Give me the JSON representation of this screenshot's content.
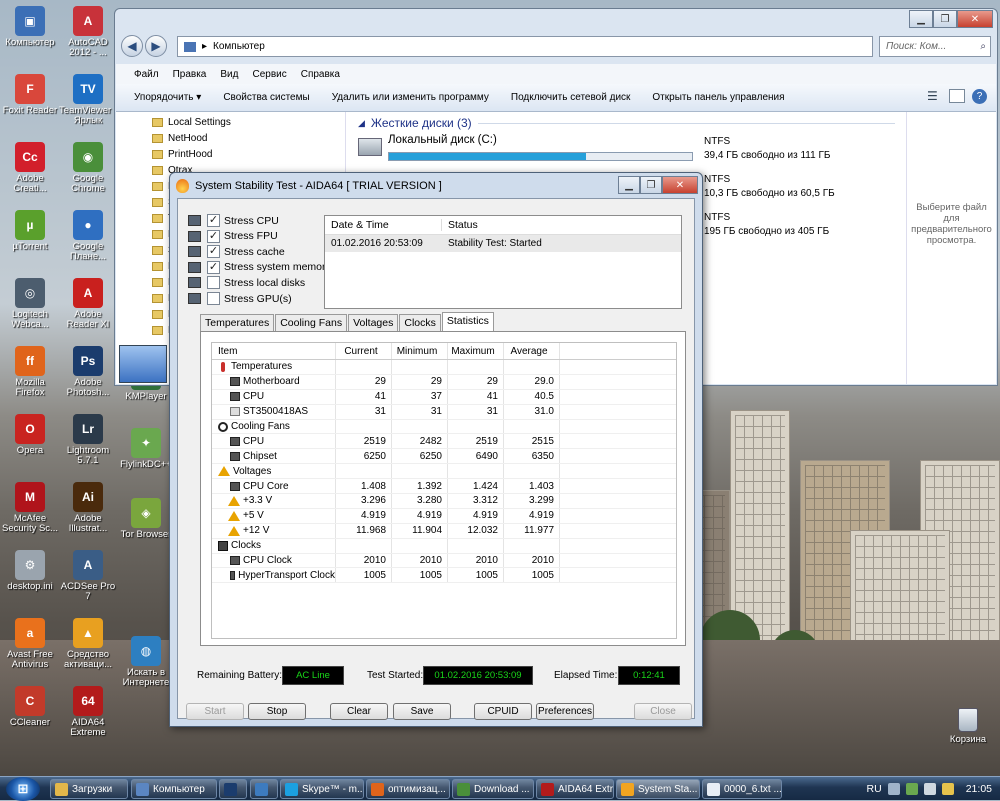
{
  "desktop": {
    "icons": [
      {
        "label": "Компьютер",
        "color": "#3b6fb6",
        "glyph": "▣"
      },
      {
        "label": "AutoCAD 2012 - ...",
        "color": "#c8323a",
        "glyph": "A"
      },
      {
        "label": "Foxit Reader",
        "color": "#d9473b",
        "glyph": "F"
      },
      {
        "label": "TeamViewer - Ярлык",
        "color": "#1e6fc4",
        "glyph": "TV"
      },
      {
        "label": "Adobe Creati...",
        "color": "#d21f2b",
        "glyph": "Cc"
      },
      {
        "label": "Google Chrome",
        "color": "#4a8f3a",
        "glyph": "◉"
      },
      {
        "label": "µTorrent",
        "color": "#5aa02c",
        "glyph": "µ"
      },
      {
        "label": "Google Плане...",
        "color": "#2f6fc1",
        "glyph": "●"
      },
      {
        "label": "Logitech Webca...",
        "color": "#4c5d6e",
        "glyph": "◎"
      },
      {
        "label": "Adobe Reader XI",
        "color": "#c9201e",
        "glyph": "A"
      },
      {
        "label": "Mozilla Firefox",
        "color": "#e0641b",
        "glyph": "ff"
      },
      {
        "label": "Adobe Photosh...",
        "color": "#1b3c6d",
        "glyph": "Ps"
      },
      {
        "label": "Opera",
        "color": "#c92420",
        "glyph": "O"
      },
      {
        "label": "Lightroom 5.7.1",
        "color": "#2b3a4a",
        "glyph": "Lr"
      },
      {
        "label": "McAfee Security Sc...",
        "color": "#b0141b",
        "glyph": "M"
      },
      {
        "label": "Adobe Illustrat...",
        "color": "#4a2a0c",
        "glyph": "Ai"
      },
      {
        "label": "desktop.ini",
        "color": "#9aa4ae",
        "glyph": "⚙"
      },
      {
        "label": "ACDSee Pro 7",
        "color": "#3a5d86",
        "glyph": "A"
      },
      {
        "label": "Avast Free Antivirus",
        "color": "#e9711c",
        "glyph": "a"
      },
      {
        "label": "Средство активаци...",
        "color": "#e8a020",
        "glyph": "▲"
      },
      {
        "label": "CCleaner",
        "color": "#c23a2a",
        "glyph": "C"
      },
      {
        "label": "AIDA64 Extreme",
        "color": "#b31b1b",
        "glyph": "64"
      }
    ],
    "col3": [
      {
        "label": "KMPlayer",
        "color": "#2f6f3a",
        "glyph": "▶"
      },
      {
        "label": "FlylinkDC++",
        "color": "#6aa84f",
        "glyph": "✦"
      },
      {
        "label": "Tor Browser",
        "color": "#7aa63d",
        "glyph": "◈"
      },
      {
        "label": "Искать в Интернете",
        "color": "#2d7fc1",
        "glyph": "◍"
      }
    ],
    "recycle_label": "Корзина"
  },
  "explorer": {
    "address": "Компьютер",
    "search_placeholder": "Поиск: Ком...",
    "menu": [
      "Файл",
      "Правка",
      "Вид",
      "Сервис",
      "Справка"
    ],
    "toolbar": [
      "Упорядочить ▾",
      "Свойства системы",
      "Удалить или изменить программу",
      "Подключить сетевой диск",
      "Открыть панель управления"
    ],
    "nav": [
      "Local Settings",
      "NetHood",
      "PrintHood",
      "Qtrax",
      "R",
      "S",
      "T",
      "П",
      "З",
      "И",
      "И",
      "К",
      "М",
      "М"
    ],
    "section_title": "Жесткие диски (3)",
    "drives": [
      {
        "name": "Локальный диск (C:)",
        "fs": "NTFS",
        "free": "39,4 ГБ свободно из 111 ГБ",
        "fill": 0.65
      },
      {
        "name": "",
        "fs": "NTFS",
        "free": "10,3 ГБ свободно из 60,5 ГБ",
        "fill": 0.83
      },
      {
        "name": "",
        "fs": "NTFS",
        "free": "195 ГБ свободно из 405 ГБ",
        "fill": 0.52
      }
    ],
    "preview_text": "Выберите файл для предварительного просмотра."
  },
  "aida": {
    "title": "System Stability Test - AIDA64  [ TRIAL VERSION ]",
    "checks": [
      {
        "label": "Stress CPU",
        "checked": true
      },
      {
        "label": "Stress FPU",
        "checked": true
      },
      {
        "label": "Stress cache",
        "checked": true
      },
      {
        "label": "Stress system memory",
        "checked": true
      },
      {
        "label": "Stress local disks",
        "checked": false
      },
      {
        "label": "Stress GPU(s)",
        "checked": false
      }
    ],
    "log_headers": [
      "Date & Time",
      "Status"
    ],
    "log_rows": [
      {
        "time": "01.02.2016 20:53:09",
        "status": "Stability Test: Started"
      }
    ],
    "tabs": [
      "Temperatures",
      "Cooling Fans",
      "Voltages",
      "Clocks",
      "Statistics"
    ],
    "active_tab": "Statistics",
    "grid_headers": [
      "Item",
      "Current",
      "Minimum",
      "Maximum",
      "Average"
    ],
    "rows": [
      {
        "type": "cat",
        "icon": "therm",
        "item": "Temperatures"
      },
      {
        "type": "item",
        "icon": "chip",
        "item": "Motherboard",
        "v": [
          "29",
          "29",
          "29",
          "29.0"
        ]
      },
      {
        "type": "item",
        "icon": "chip",
        "item": "CPU",
        "v": [
          "41",
          "37",
          "41",
          "40.5"
        ]
      },
      {
        "type": "item",
        "icon": "disk",
        "item": "ST3500418AS",
        "v": [
          "31",
          "31",
          "31",
          "31.0"
        ]
      },
      {
        "type": "cat",
        "icon": "fan",
        "item": "Cooling Fans"
      },
      {
        "type": "item",
        "icon": "chip",
        "item": "CPU",
        "v": [
          "2519",
          "2482",
          "2519",
          "2515"
        ]
      },
      {
        "type": "item",
        "icon": "chip",
        "item": "Chipset",
        "v": [
          "6250",
          "6250",
          "6490",
          "6350"
        ]
      },
      {
        "type": "cat",
        "icon": "warn",
        "item": "Voltages"
      },
      {
        "type": "item",
        "icon": "chip",
        "item": "CPU Core",
        "v": [
          "1.408",
          "1.392",
          "1.424",
          "1.403"
        ]
      },
      {
        "type": "item",
        "icon": "warn",
        "item": "+3.3 V",
        "v": [
          "3.296",
          "3.280",
          "3.312",
          "3.299"
        ]
      },
      {
        "type": "item",
        "icon": "warn",
        "item": "+5 V",
        "v": [
          "4.919",
          "4.919",
          "4.919",
          "4.919"
        ]
      },
      {
        "type": "item",
        "icon": "warn",
        "item": "+12 V",
        "v": [
          "11.968",
          "11.904",
          "12.032",
          "11.977"
        ]
      },
      {
        "type": "cat",
        "icon": "clock",
        "item": "Clocks"
      },
      {
        "type": "item",
        "icon": "chip",
        "item": "CPU Clock",
        "v": [
          "2010",
          "2010",
          "2010",
          "2010"
        ]
      },
      {
        "type": "item",
        "icon": "chip",
        "item": "HyperTransport Clock",
        "v": [
          "1005",
          "1005",
          "1005",
          "1005"
        ]
      }
    ],
    "status": {
      "battery_label": "Remaining Battery:",
      "battery_value": "AC Line",
      "started_label": "Test Started:",
      "started_value": "01.02.2016 20:53:09",
      "elapsed_label": "Elapsed Time:",
      "elapsed_value": "0:12:41"
    },
    "buttons": {
      "start": "Start",
      "stop": "Stop",
      "clear": "Clear",
      "save": "Save",
      "cpuid": "CPUID",
      "prefs": "Preferences",
      "close": "Close"
    }
  },
  "taskbar": {
    "start_glyph": "⊞",
    "items": [
      {
        "label": "Загрузки",
        "color": "#e3b74a",
        "active": false
      },
      {
        "label": "Компьютер",
        "color": "#5b86c2",
        "active": false
      },
      {
        "label": "",
        "color": "#1b3c6d",
        "active": false
      },
      {
        "label": "",
        "color": "#3d7bbf",
        "active": false
      },
      {
        "label": "Skype™ - m...",
        "color": "#1ba0e1",
        "active": false
      },
      {
        "label": "оптимизац...",
        "color": "#e0641b",
        "active": false
      },
      {
        "label": "Download ...",
        "color": "#4a8f3a",
        "active": false
      },
      {
        "label": "AIDA64 Extr...",
        "color": "#b31b1b",
        "active": false
      },
      {
        "label": "System Sta...",
        "color": "#f2a420",
        "active": true
      },
      {
        "label": "0000_6.txt ...",
        "color": "#e8eef5",
        "active": false
      }
    ],
    "lang": "RU",
    "time": "21:05"
  },
  "colors": {
    "lcd_text": "#19d519",
    "drive_fill": "#26a0da"
  }
}
